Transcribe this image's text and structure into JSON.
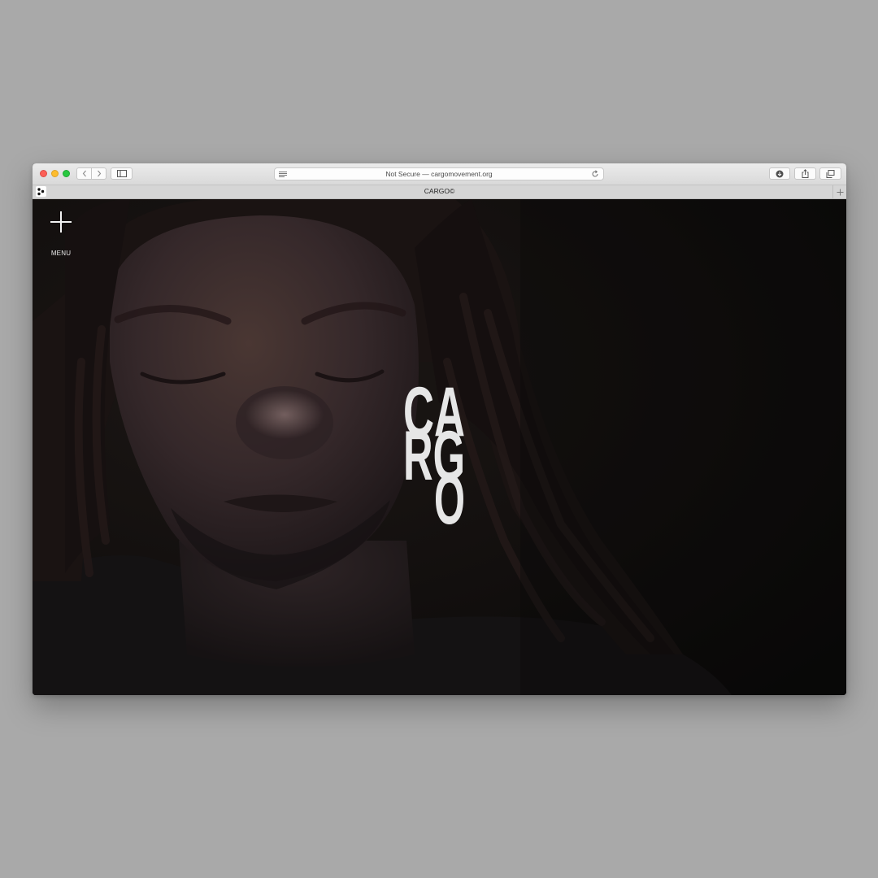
{
  "browser": {
    "address": "Not Secure — cargomovement.org",
    "tab_title": "CARGO©"
  },
  "page": {
    "menu_label": "MENU",
    "logo": [
      "CA",
      "RG",
      "O"
    ]
  },
  "colors": {
    "background": "#a9a9a9",
    "content_bg": "#0d0b0a",
    "logo": "#e6e6e6"
  }
}
